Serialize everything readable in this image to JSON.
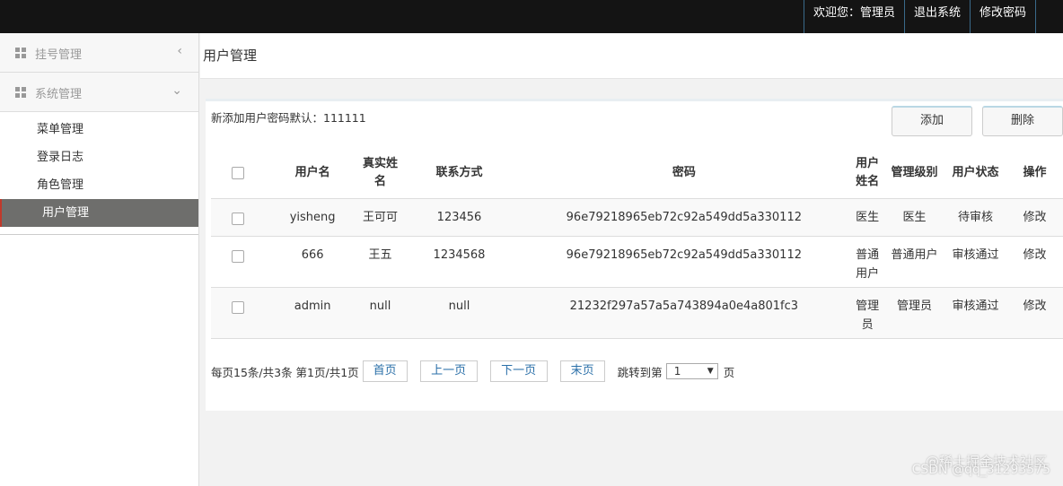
{
  "topbar": {
    "welcome": "欢迎您：管理员",
    "logout": "退出系统",
    "change_password": "修改密码"
  },
  "sidebar": {
    "groups": [
      {
        "label": "挂号管理",
        "icon": "grid-icon",
        "chevron": "‹"
      },
      {
        "label": "系统管理",
        "icon": "grid-icon",
        "chevron": "⌄"
      }
    ],
    "items": [
      {
        "label": "菜单管理"
      },
      {
        "label": "登录日志"
      },
      {
        "label": "角色管理"
      },
      {
        "label": "用户管理",
        "active": true
      }
    ]
  },
  "header": {
    "title": "用户管理"
  },
  "panel": {
    "notice": "新添加用户密码默认：111111",
    "add_label": "添加",
    "delete_label": "删除"
  },
  "table": {
    "columns": [
      "用户名",
      "真实姓名",
      "联系方式",
      "密码",
      "用户姓名",
      "管理级别",
      "用户状态",
      "操作"
    ],
    "rows": [
      {
        "username": "yisheng",
        "realname": "王可可",
        "contact": "123456",
        "password": "96e79218965eb72c92a549dd5a330112",
        "user_name": "医生",
        "level": "医生",
        "status": "待审核",
        "action": "修改"
      },
      {
        "username": "666",
        "realname": "王五",
        "contact": "1234568",
        "password": "96e79218965eb72c92a549dd5a330112",
        "user_name": "普通用户",
        "level": "普通用户",
        "status": "审核通过",
        "action": "修改"
      },
      {
        "username": "admin",
        "realname": "null",
        "contact": "null",
        "password": "21232f297a57a5a743894a0e4a801fc3",
        "user_name": "管理员",
        "level": "管理员",
        "status": "审核通过",
        "action": "修改"
      }
    ]
  },
  "pager": {
    "summary": "每页15条/共3条 第1页/共1页",
    "first": "首页",
    "prev": "上一页",
    "next": "下一页",
    "last": "末页",
    "jump_prefix": "跳转到第",
    "jump_value": "1",
    "jump_suffix": "页"
  },
  "watermark": {
    "line1": "@稀土掘金技术社区",
    "line2": "CSDN @qq_31293575"
  }
}
